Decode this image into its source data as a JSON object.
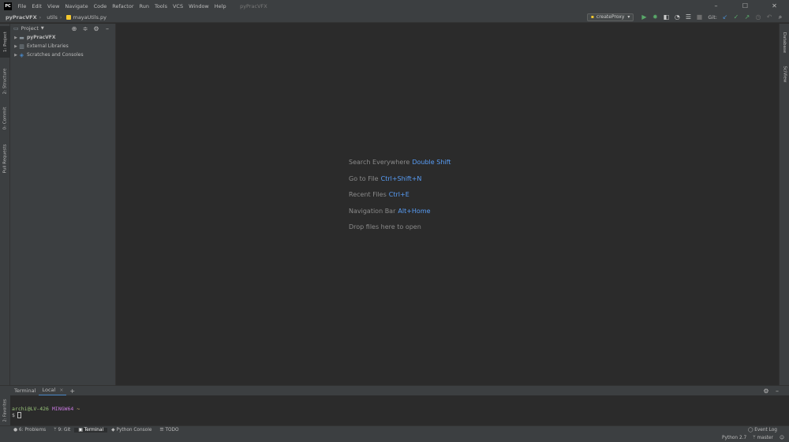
{
  "menubar": {
    "logo": "PC",
    "items": [
      "File",
      "Edit",
      "View",
      "Navigate",
      "Code",
      "Refactor",
      "Run",
      "Tools",
      "VCS",
      "Window",
      "Help"
    ],
    "window_title": "pyPracVFX"
  },
  "navbar": {
    "breadcrumbs": [
      "pyPracVFX",
      "utils",
      "mayaUtils.py"
    ],
    "run_config": "createProxy",
    "git_label": "Git:"
  },
  "left_tabs": [
    "1: Project",
    "2: Structure",
    "0: Commit",
    "Pull Requests"
  ],
  "right_tabs": [
    "Database",
    "SciView"
  ],
  "project_panel": {
    "title": "Project",
    "tree": [
      {
        "label": "pyPracVFX",
        "bold": true,
        "icon": "folder-icon"
      },
      {
        "label": "External Libraries",
        "bold": false,
        "icon": "library-icon"
      },
      {
        "label": "Scratches and Consoles",
        "bold": false,
        "icon": "scratch-icon"
      }
    ]
  },
  "editor": {
    "hints": [
      {
        "text": "Search Everywhere",
        "key": "Double Shift"
      },
      {
        "text": "Go to File",
        "key": "Ctrl+Shift+N"
      },
      {
        "text": "Recent Files",
        "key": "Ctrl+E"
      },
      {
        "text": "Navigation Bar",
        "key": "Alt+Home"
      },
      {
        "text": "Drop files here to open",
        "key": ""
      }
    ]
  },
  "terminal": {
    "tabs": [
      "Terminal",
      "Local"
    ],
    "user": "archi@LV-426",
    "host": "MINGW64",
    "path": "~",
    "prompt": "$"
  },
  "bottom_tabs": [
    "6: Problems",
    "9: Git",
    "Terminal",
    "Python Console",
    "TODO"
  ],
  "event_log": "Event Log",
  "status": {
    "interpreter": "Python 2.7",
    "branch": "master"
  }
}
